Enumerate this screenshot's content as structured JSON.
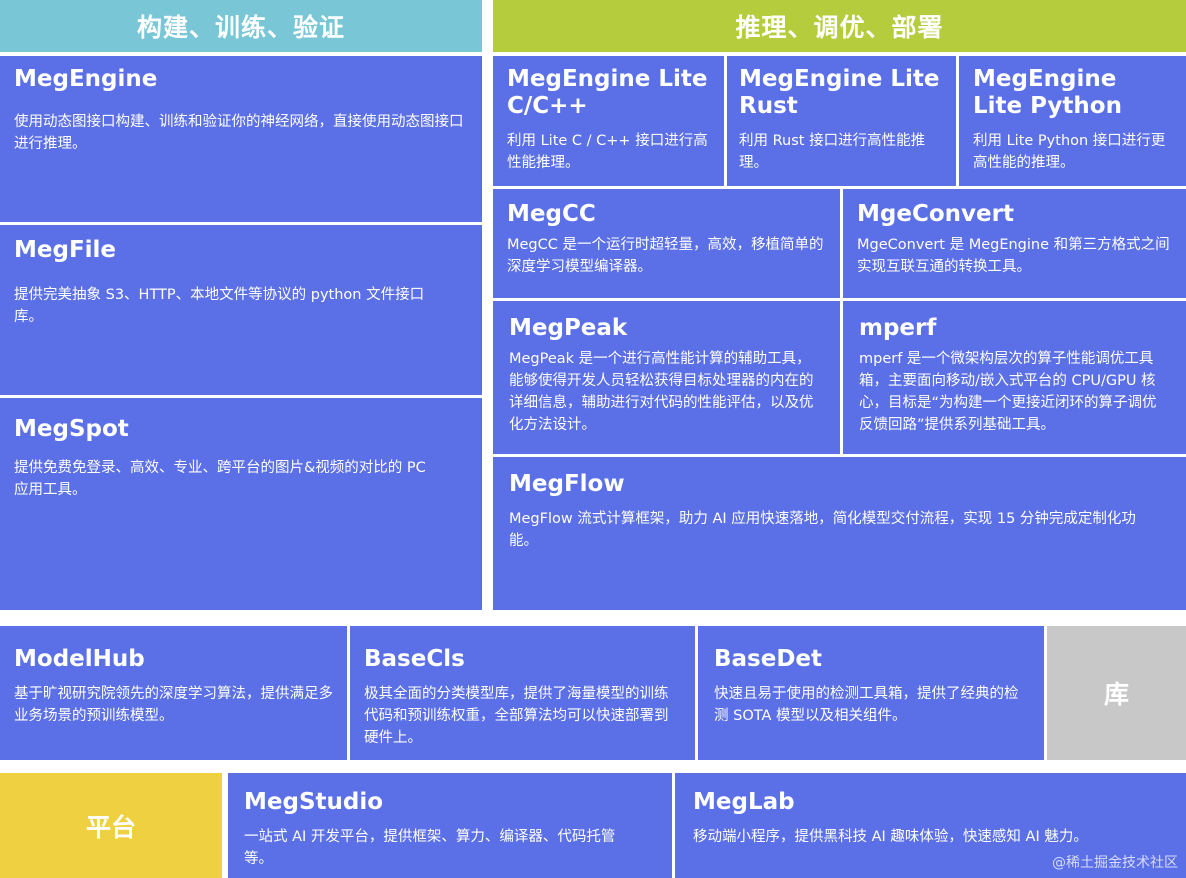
{
  "headers": {
    "left": "构建、训练、验证",
    "right": "推理、调优、部署"
  },
  "left_column": [
    {
      "title": "MegEngine",
      "desc": "使用动态图接口构建、训练和验证你的神经网络，直接使用动态图接口进行推理。"
    },
    {
      "title": "MegFile",
      "desc": "提供完美抽象 S3、HTTP、本地文件等协议的 python 文件接口库。"
    },
    {
      "title": "MegSpot",
      "desc": "提供免费免登录、高效、专业、跨平台的图片&视频的对比的 PC 应用工具。"
    }
  ],
  "lite_row": [
    {
      "title": "MegEngine Lite C/C++",
      "desc": "利用 Lite C / C++ 接口进行高性能推理。"
    },
    {
      "title": "MegEngine Lite Rust",
      "desc": "利用 Rust 接口进行高性能推理。"
    },
    {
      "title": "MegEngine Lite Python",
      "desc": "利用 Lite Python 接口进行更高性能的推理。"
    }
  ],
  "right_mid": [
    {
      "title": "MegCC",
      "desc": "MegCC 是一个运行时超轻量，高效，移植简单的深度学习模型编译器。"
    },
    {
      "title": "MgeConvert",
      "desc": "MgeConvert 是 MegEngine 和第三方格式之间实现互联互通的转换工具。"
    },
    {
      "title": "MegPeak",
      "desc": "MegPeak 是一个进行高性能计算的辅助工具，能够使得开发人员轻松获得目标处理器的内在的详细信息，辅助进行对代码的性能评估，以及优化方法设计。"
    },
    {
      "title": "mperf",
      "desc": "mperf 是一个微架构层次的算子性能调优工具箱，主要面向移动/嵌入式平台的 CPU/GPU 核心，目标是“为构建一个更接近闭环的算子调优反馈回路”提供系列基础工具。"
    }
  ],
  "megflow": {
    "title": "MegFlow",
    "desc": "MegFlow 流式计算框架，助力 AI 应用快速落地，简化模型交付流程，实现 15 分钟完成定制化功能。"
  },
  "library_row": {
    "items": [
      {
        "title": "ModelHub",
        "desc": "基于旷视研究院领先的深度学习算法，提供满足多业务场景的预训练模型。"
      },
      {
        "title": "BaseCls",
        "desc": "极其全面的分类模型库，提供了海量模型的训练代码和预训练权重，全部算法均可以快速部署到硬件上。"
      },
      {
        "title": "BaseDet",
        "desc": "快速且易于使用的检测工具箱，提供了经典的检测 SOTA 模型以及相关组件。"
      }
    ],
    "label": "库"
  },
  "platform_row": {
    "label": "平台",
    "items": [
      {
        "title": "MegStudio",
        "desc": "一站式 AI 开发平台，提供框架、算力、编译器、代码托管等。"
      },
      {
        "title": "MegLab",
        "desc": "移动端小程序，提供黑科技 AI 趣味体验，快速感知 AI 魅力。"
      }
    ]
  },
  "watermark": "@稀土掘金技术社区",
  "colors": {
    "box": "#5b6fe6",
    "header_left": "#79c6d6",
    "header_right": "#b5cc3c",
    "library_label": "#c8c8c8",
    "platform_label": "#eed040"
  }
}
